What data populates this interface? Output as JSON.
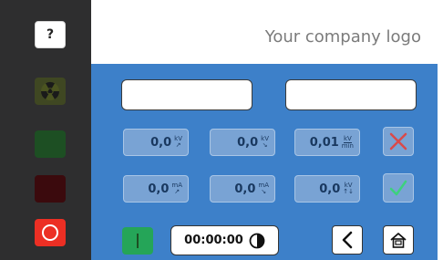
{
  "header": {
    "logo_text": "Your company logo"
  },
  "sidebar": {
    "help_label": "?",
    "radiation_icon": "radiation-icon",
    "stop_icon": "circle-icon"
  },
  "fields": {
    "field_a_value": "",
    "field_b_value": ""
  },
  "values": {
    "row1": [
      {
        "value": "0,0",
        "unit_top": "kV",
        "unit_bottom": "↗"
      },
      {
        "value": "0,0",
        "unit_top": "kV",
        "unit_bottom": "↘"
      },
      {
        "value": "0,01",
        "unit_top": "kV",
        "unit_bottom": "min"
      }
    ],
    "row2": [
      {
        "value": "0,0",
        "unit_top": "mA",
        "unit_bottom": "↗"
      },
      {
        "value": "0,0",
        "unit_top": "mA",
        "unit_bottom": "↘"
      },
      {
        "value": "0,0",
        "unit_top": "kV",
        "unit_bottom": "↑↓"
      }
    ]
  },
  "controls": {
    "timer": "00:00:00",
    "cancel_icon": "x-icon",
    "confirm_icon": "check-icon",
    "back_icon": "chevron-left-icon",
    "home_icon": "home-icon"
  },
  "colors": {
    "panel": "#3d80c9",
    "sidebar": "#2e2e2f",
    "stop": "#ec2f24",
    "start": "#25a558"
  }
}
